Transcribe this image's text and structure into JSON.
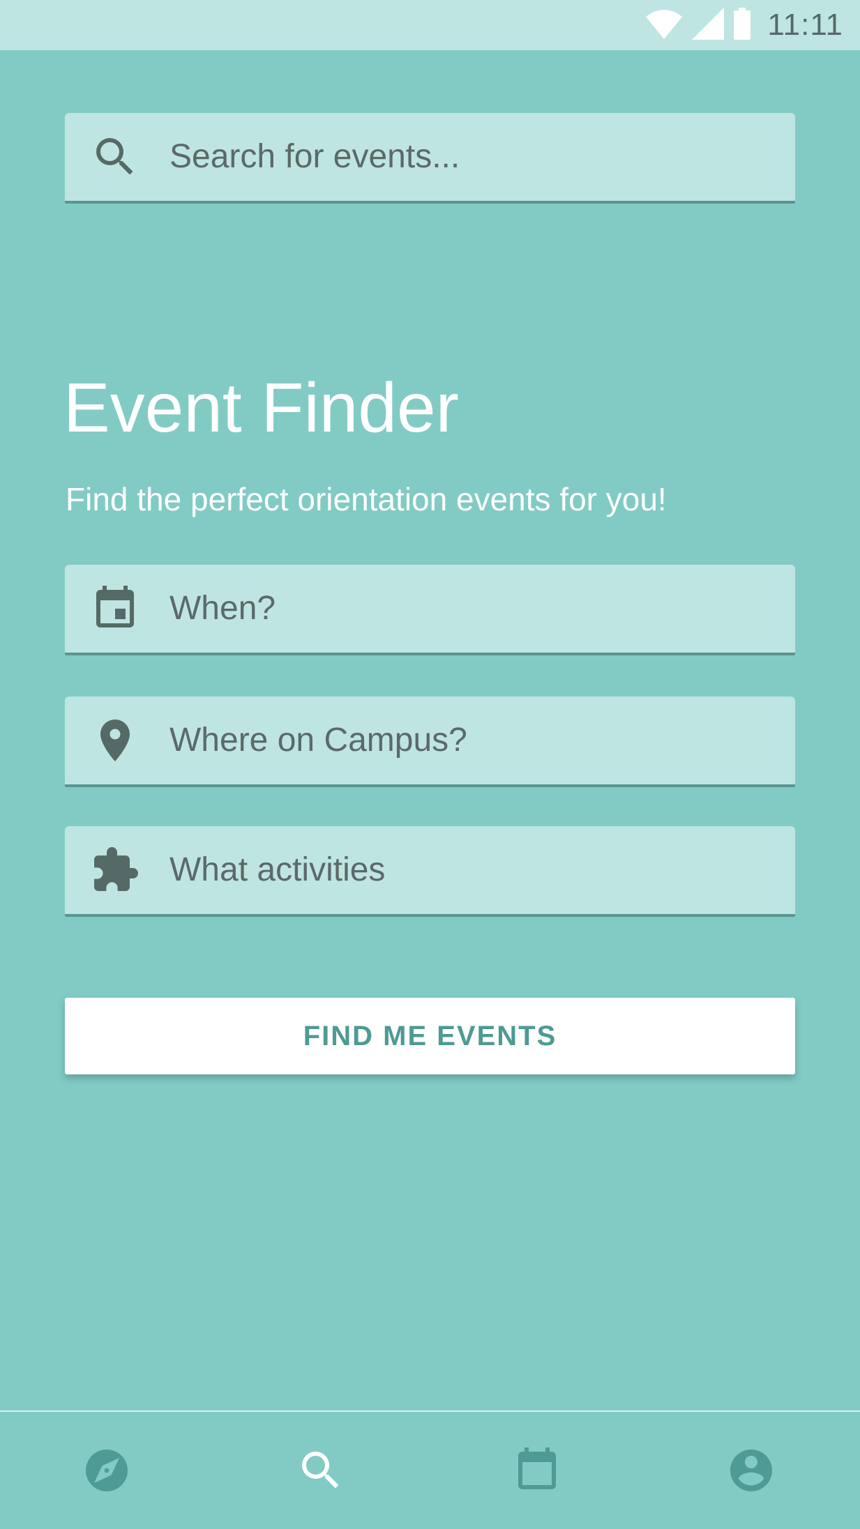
{
  "status_bar": {
    "time": "11:11",
    "icons": [
      "wifi-icon",
      "cell-signal-icon",
      "battery-icon"
    ]
  },
  "search": {
    "placeholder": "Search for events...",
    "icon": "search-icon"
  },
  "header": {
    "title": "Event Finder",
    "subtitle": "Find the perfect orientation events for you!"
  },
  "filters": [
    {
      "label": "When?",
      "icon": "calendar-icon"
    },
    {
      "label": "Where on Campus?",
      "icon": "location-pin-icon"
    },
    {
      "label": "What activities",
      "icon": "puzzle-icon"
    }
  ],
  "cta": {
    "label": "FIND ME EVENTS"
  },
  "bottom_nav": {
    "items": [
      {
        "icon": "explore-compass-icon",
        "active": false
      },
      {
        "icon": "search-icon",
        "active": true
      },
      {
        "icon": "calendar-icon",
        "active": false
      },
      {
        "icon": "account-icon",
        "active": false
      }
    ]
  },
  "colors": {
    "background": "#82cbc4",
    "field": "#bfe5e2",
    "nav_icon": "#4e9a94",
    "active_nav_icon": "#ffffff",
    "input_text": "#5a6a68"
  }
}
